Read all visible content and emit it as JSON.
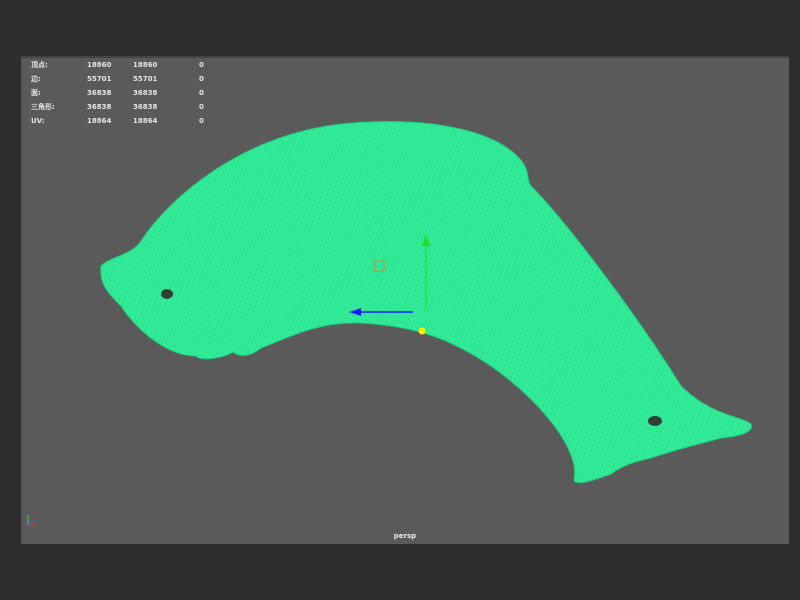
{
  "viewport": {
    "camera_label": "persp",
    "background": "#5a5a5a",
    "mesh_color": "#33ee99",
    "wire_color": "#1ab877"
  },
  "stats": [
    {
      "label": "顶点:",
      "v1": "18860",
      "v2": "18860",
      "v3": "0"
    },
    {
      "label": "边:",
      "v1": "55701",
      "v2": "55701",
      "v3": "0"
    },
    {
      "label": "面:",
      "v1": "36838",
      "v2": "36838",
      "v3": "0"
    },
    {
      "label": "三角形:",
      "v1": "36838",
      "v2": "36838",
      "v3": "0"
    },
    {
      "label": "UV:",
      "v1": "18864",
      "v2": "18864",
      "v3": "0"
    }
  ],
  "manipulator": {
    "y_axis_color": "#22dd22",
    "x_axis_color": "#1a1aff",
    "pivot_color": "#ffee00"
  },
  "icons": {
    "axis_indicator": "axis-triad-icon"
  }
}
